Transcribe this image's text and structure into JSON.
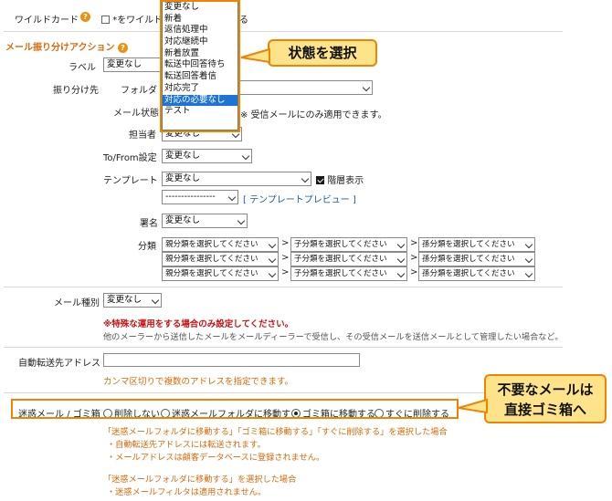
{
  "wildcard": {
    "label": "ワイルドカード",
    "checkbox_text": "*をワイルド",
    "checkbox_text_tail": "る"
  },
  "section": {
    "title": "メール振り分けアクション"
  },
  "label_row": {
    "label": "ラベル",
    "value": "変更なし"
  },
  "destination": {
    "label": "振り分け先",
    "folder_label": "フォルダ",
    "status_label": "メール状態",
    "status_note": "※ 受信メールにのみ適用できます。",
    "assignee_label": "担当者",
    "assignee_value": "変更なし"
  },
  "status_dropdown": {
    "options": [
      "変更なし",
      "新着",
      "返信処理中",
      "対応継続中",
      "新着放置",
      "転送中回答待ち",
      "転送回答着信",
      "対応完了",
      "対応の必要なし",
      "テスト"
    ],
    "highlighted": "対応の必要なし"
  },
  "callout_top": {
    "text": "状態を選択"
  },
  "tofrom": {
    "label": "To/From設定",
    "value": "変更なし"
  },
  "template": {
    "label": "テンプレート",
    "value": "変更なし",
    "hier_label": "階層表示",
    "sub_value": "----------------",
    "preview_link": "[ テンプレートプレビュー ]"
  },
  "signature": {
    "label": "署名",
    "value": "変更なし"
  },
  "category": {
    "label": "分類",
    "parent": "親分類を選択してください",
    "child": "子分類を選択してください",
    "grandchild": "孫分類を選択してください",
    "sep": ">"
  },
  "mailtype": {
    "label": "メール種別",
    "value": "変更なし",
    "warning": "※特殊な運用をする場合のみ設定してください。",
    "desc": "他のメーラーから送信したメールをメールディーラーで受信し、その受信メールを送信メールとして管理したい場合など。"
  },
  "autoforward": {
    "label": "自動転送先アドレス",
    "note": "カンマ区切りで複数のアドレスを指定できます。"
  },
  "spam": {
    "label": "迷惑メール / ゴミ箱",
    "options": [
      "削除しない",
      "迷惑メールフォルダに移動する",
      "ゴミ箱に移動する",
      "すぐに削除する"
    ],
    "selected": "ゴミ箱に移動する",
    "note1": "「迷惑メールフォルダに移動する」「ゴミ箱に移動する」「すぐに削除する」を選択した場合",
    "note2": "・自動転送先アドレスには転送されます。",
    "note3": "・メールアドレスは顧客データベースに登録されません。",
    "note4": "「迷惑メールフォルダに移動する」を選択した場合",
    "note5": "・迷惑メールフィルタは適用されません。"
  },
  "callout_bottom": {
    "line1": "不要なメールは",
    "line2": "直接ゴミ箱へ"
  },
  "colors": {
    "accent": "#f08300",
    "callout_bg": "#fde38a",
    "highlight": "#1e73d6",
    "warning": "#cc1111",
    "note": "#d86a0a"
  }
}
